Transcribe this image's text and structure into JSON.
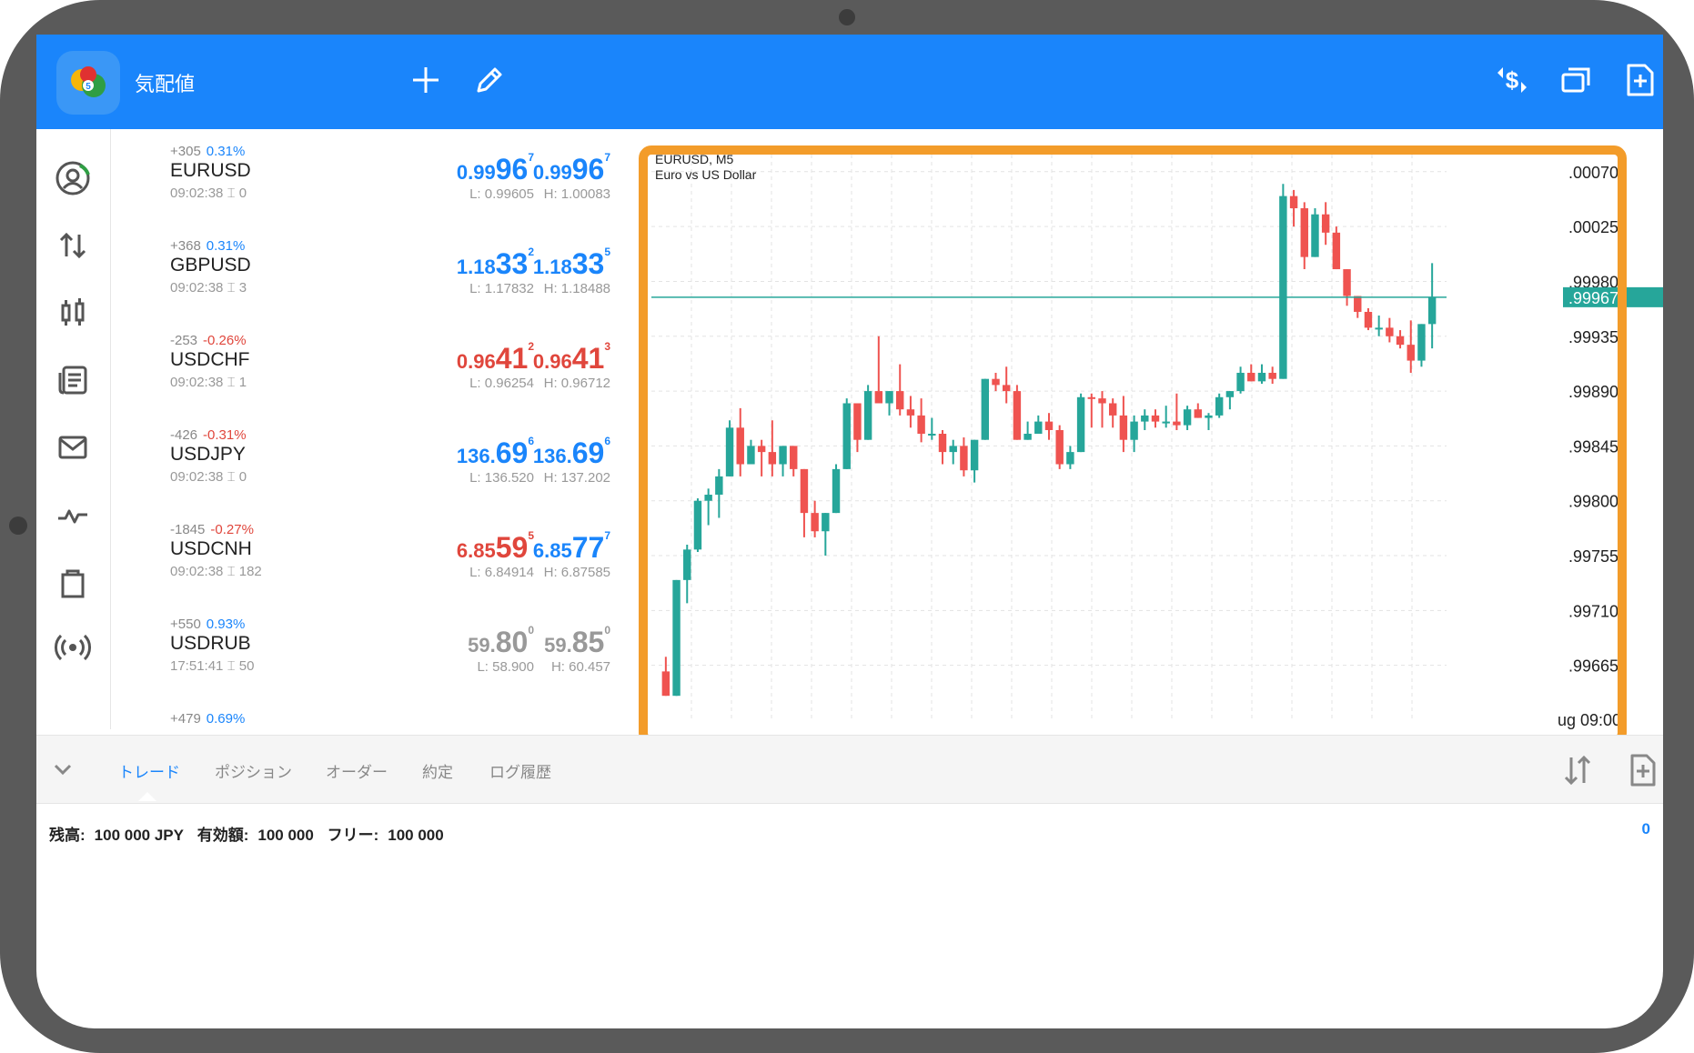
{
  "app": {
    "title": "気配値",
    "logo_icon": "metatrader-logo-icon"
  },
  "toolbar": {
    "icons": [
      "plus-icon",
      "pencil-icon",
      "dollar-exchange-icon",
      "windows-icon",
      "new-document-icon"
    ]
  },
  "sidebar": {
    "icons": [
      "account-icon",
      "trade-arrows-icon",
      "candlestick-icon",
      "news-icon",
      "mail-icon",
      "pulse-icon",
      "bag-icon",
      "signal-icon"
    ]
  },
  "quotes": [
    {
      "change": "+305",
      "pct": "0.31%",
      "symbol": "EURUSD",
      "time": "09:02:38",
      "spread": "0",
      "bid": {
        "sm": "0.99",
        "big": "96",
        "sup": "7"
      },
      "ask": {
        "sm": "0.99",
        "big": "96",
        "sup": "7"
      },
      "low": "L: 0.99605",
      "high": "H: 1.00083",
      "dir": "up"
    },
    {
      "change": "+368",
      "pct": "0.31%",
      "symbol": "GBPUSD",
      "time": "09:02:38",
      "spread": "3",
      "bid": {
        "sm": "1.18",
        "big": "33",
        "sup": "2"
      },
      "ask": {
        "sm": "1.18",
        "big": "33",
        "sup": "5"
      },
      "low": "L: 1.17832",
      "high": "H: 1.18488",
      "dir": "up"
    },
    {
      "change": "-253",
      "pct": "-0.26%",
      "symbol": "USDCHF",
      "time": "09:02:38",
      "spread": "1",
      "bid": {
        "sm": "0.96",
        "big": "41",
        "sup": "2"
      },
      "ask": {
        "sm": "0.96",
        "big": "41",
        "sup": "3"
      },
      "low": "L: 0.96254",
      "high": "H: 0.96712",
      "dir": "down"
    },
    {
      "change": "-426",
      "pct": "-0.31%",
      "symbol": "USDJPY",
      "time": "09:02:38",
      "spread": "0",
      "bid": {
        "sm": "136.",
        "big": "69",
        "sup": "6"
      },
      "ask": {
        "sm": "136.",
        "big": "69",
        "sup": "6"
      },
      "low": "L: 136.520",
      "high": "H: 137.202",
      "dir": "up"
    },
    {
      "change": "-1845",
      "pct": "-0.27%",
      "symbol": "USDCNH",
      "time": "09:02:38",
      "spread": "182",
      "bid": {
        "sm": "6.85",
        "big": "59",
        "sup": "5"
      },
      "ask": {
        "sm": "6.85",
        "big": "77",
        "sup": "7"
      },
      "low": "L: 6.84914",
      "high": "H: 6.87585",
      "dir": "mixed"
    },
    {
      "change": "+550",
      "pct": "0.93%",
      "symbol": "USDRUB",
      "time": "17:51:41",
      "spread": "50",
      "bid": {
        "sm": "59.",
        "big": "80",
        "sup": "0"
      },
      "ask": {
        "sm": "59.",
        "big": "85",
        "sup": "0"
      },
      "low": "L: 58.900",
      "high": "H: 60.457",
      "dir": "flat"
    },
    {
      "change": "+479",
      "pct": "0.69%",
      "symbol": "",
      "time": "",
      "spread": "",
      "bid": {
        "sm": "",
        "big": "",
        "sup": ""
      },
      "ask": {
        "sm": "",
        "big": "",
        "sup": ""
      },
      "low": "",
      "high": "",
      "dir": "up"
    }
  ],
  "chart": {
    "symbol_line": "EURUSD, M5",
    "desc_line": "Euro vs US Dollar",
    "y_ticks": [
      ".00070",
      ".00025",
      ".99980",
      ".99935",
      ".99890",
      ".99845",
      ".99800",
      ".99755",
      ".99710",
      ".99665"
    ],
    "current_price": ".99967",
    "time_label": "ug 09:00",
    "colors": {
      "up": "#26a69a",
      "down": "#ef5350",
      "highlight": "#f39c2a"
    }
  },
  "chart_data": {
    "type": "candlestick",
    "title": "EURUSD, M5",
    "subtitle": "Euro vs US Dollar",
    "ylim": [
      0.9962,
      1.0009
    ],
    "current_price": 0.99967,
    "ohlc": [
      [
        0.9966,
        0.99672,
        0.9964,
        0.9964
      ],
      [
        0.9964,
        0.99735,
        0.9964,
        0.99735
      ],
      [
        0.99735,
        0.99764,
        0.99716,
        0.9976
      ],
      [
        0.9976,
        0.99802,
        0.99758,
        0.998
      ],
      [
        0.998,
        0.9981,
        0.9978,
        0.99805
      ],
      [
        0.99805,
        0.99826,
        0.99786,
        0.9982
      ],
      [
        0.9982,
        0.99866,
        0.9982,
        0.9986
      ],
      [
        0.9986,
        0.99876,
        0.9982,
        0.9983
      ],
      [
        0.9983,
        0.9985,
        0.9983,
        0.99845
      ],
      [
        0.99845,
        0.9985,
        0.9982,
        0.9984
      ],
      [
        0.9984,
        0.99866,
        0.9982,
        0.9983
      ],
      [
        0.9983,
        0.99845,
        0.9982,
        0.99845
      ],
      [
        0.99845,
        0.99845,
        0.9982,
        0.99826
      ],
      [
        0.99826,
        0.99826,
        0.9977,
        0.9979
      ],
      [
        0.9979,
        0.998,
        0.9977,
        0.99775
      ],
      [
        0.99775,
        0.9979,
        0.99755,
        0.9979
      ],
      [
        0.9979,
        0.9983,
        0.9979,
        0.99826
      ],
      [
        0.99826,
        0.99884,
        0.99826,
        0.9988
      ],
      [
        0.9988,
        0.9988,
        0.9984,
        0.9985
      ],
      [
        0.9985,
        0.99895,
        0.9985,
        0.9989
      ],
      [
        0.9989,
        0.99935,
        0.9989,
        0.9988
      ],
      [
        0.9988,
        0.9989,
        0.9987,
        0.9989
      ],
      [
        0.9989,
        0.99912,
        0.9987,
        0.99875
      ],
      [
        0.99875,
        0.99886,
        0.9986,
        0.9987
      ],
      [
        0.9987,
        0.99884,
        0.99848,
        0.99855
      ],
      [
        0.99855,
        0.99868,
        0.9985,
        0.99855
      ],
      [
        0.99855,
        0.99858,
        0.9983,
        0.9984
      ],
      [
        0.9984,
        0.9985,
        0.9983,
        0.99845
      ],
      [
        0.99845,
        0.99852,
        0.9982,
        0.99825
      ],
      [
        0.99825,
        0.9985,
        0.99815,
        0.9985
      ],
      [
        0.9985,
        0.999,
        0.9985,
        0.999
      ],
      [
        0.999,
        0.99905,
        0.9989,
        0.99895
      ],
      [
        0.99895,
        0.9991,
        0.9988,
        0.9989
      ],
      [
        0.9989,
        0.99895,
        0.9985,
        0.9985
      ],
      [
        0.9985,
        0.99865,
        0.9985,
        0.99855
      ],
      [
        0.99855,
        0.9987,
        0.99855,
        0.99865
      ],
      [
        0.99865,
        0.99872,
        0.9985,
        0.99858
      ],
      [
        0.99858,
        0.99862,
        0.99826,
        0.9983
      ],
      [
        0.9983,
        0.99845,
        0.99826,
        0.9984
      ],
      [
        0.9984,
        0.99888,
        0.9984,
        0.99885
      ],
      [
        0.99885,
        0.99888,
        0.9986,
        0.99884
      ],
      [
        0.99884,
        0.9989,
        0.9986,
        0.9988
      ],
      [
        0.9988,
        0.99884,
        0.9986,
        0.9987
      ],
      [
        0.9987,
        0.99886,
        0.9984,
        0.9985
      ],
      [
        0.9985,
        0.9987,
        0.9984,
        0.99865
      ],
      [
        0.99865,
        0.99875,
        0.99858,
        0.9987
      ],
      [
        0.9987,
        0.99875,
        0.9986,
        0.99865
      ],
      [
        0.99865,
        0.99878,
        0.9986,
        0.99865
      ],
      [
        0.99865,
        0.99888,
        0.99858,
        0.99862
      ],
      [
        0.99862,
        0.99878,
        0.99858,
        0.99875
      ],
      [
        0.99875,
        0.9988,
        0.99868,
        0.99868
      ],
      [
        0.99868,
        0.99872,
        0.99858,
        0.9987
      ],
      [
        0.9987,
        0.99888,
        0.99868,
        0.99885
      ],
      [
        0.99885,
        0.9989,
        0.99875,
        0.9989
      ],
      [
        0.9989,
        0.9991,
        0.99888,
        0.99905
      ],
      [
        0.99905,
        0.99912,
        0.99898,
        0.99898
      ],
      [
        0.99898,
        0.99912,
        0.99896,
        0.99905
      ],
      [
        0.99905,
        0.9991,
        0.99896,
        0.999
      ],
      [
        0.999,
        1.0006,
        0.999,
        1.0005
      ],
      [
        1.0005,
        1.00055,
        1.00025,
        1.0004
      ],
      [
        1.0004,
        1.00045,
        0.9999,
        1.0
      ],
      [
        1.0,
        1.0004,
        1.0,
        1.00035
      ],
      [
        1.00035,
        1.00045,
        1.0001,
        1.0002
      ],
      [
        1.0002,
        1.00025,
        0.9999,
        0.9999
      ],
      [
        0.9999,
        0.9999,
        0.9996,
        0.99968
      ],
      [
        0.99968,
        0.99968,
        0.9995,
        0.99955
      ],
      [
        0.99955,
        0.99958,
        0.9994,
        0.99942
      ],
      [
        0.99942,
        0.99952,
        0.99935,
        0.99942
      ],
      [
        0.99942,
        0.9995,
        0.9993,
        0.99935
      ],
      [
        0.99935,
        0.9994,
        0.99925,
        0.99928
      ],
      [
        0.99928,
        0.99948,
        0.99905,
        0.99915
      ],
      [
        0.99915,
        0.99945,
        0.9991,
        0.99945
      ],
      [
        0.99945,
        0.99995,
        0.99925,
        0.99967
      ]
    ]
  },
  "bottom": {
    "tabs": [
      "トレード",
      "ポジション",
      "オーダー",
      "約定",
      "ログ履歴"
    ],
    "active_tab": 0,
    "balance_label": "残高:",
    "balance_value": "100 000 JPY",
    "equity_label": "有効額:",
    "equity_value": "100 000",
    "free_label": "フリー:",
    "free_value": "100 000",
    "right_value": "0"
  }
}
